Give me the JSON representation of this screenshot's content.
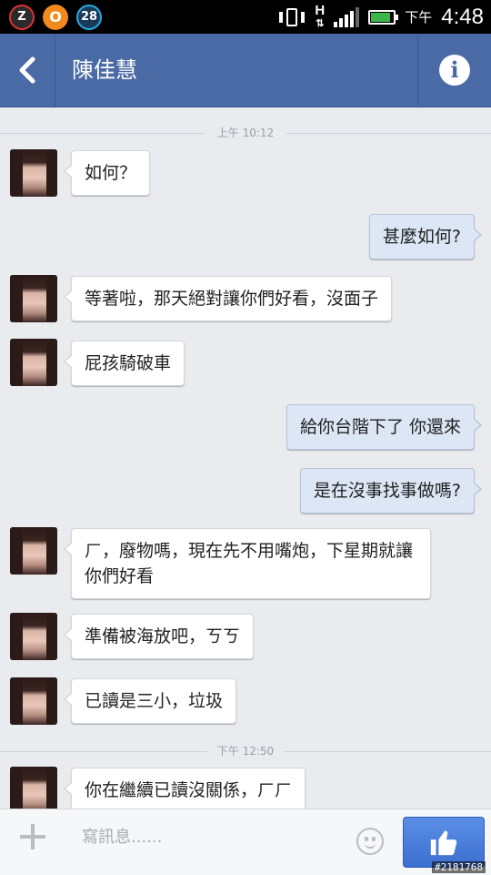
{
  "status_bar": {
    "badge_z": "Z",
    "badge_o": "O",
    "badge_28": "28",
    "network": "H",
    "ampm": "下午",
    "time": "4:48",
    "battery_level": 0.85
  },
  "header": {
    "contact_name": "陳佳慧",
    "back_icon": "chevron-left-icon",
    "info_icon": "info-icon",
    "info_symbol": "i"
  },
  "chat": {
    "timestamps": [
      "上午 10:12",
      "下午 12:50"
    ],
    "messages": [
      {
        "from": "them",
        "text": "如何？"
      },
      {
        "from": "me",
        "text": "甚麼如何?"
      },
      {
        "from": "them",
        "text": "等著啦，那天絕對讓你們好看，沒面子"
      },
      {
        "from": "them",
        "text": "屁孩騎破車"
      },
      {
        "from": "me",
        "text": "給你台階下了 你還來"
      },
      {
        "from": "me",
        "text": "是在沒事找事做嗎?"
      },
      {
        "from": "them",
        "text": "ㄏ，廢物嗎，現在先不用嘴炮，下星期就讓你們好看"
      },
      {
        "from": "them",
        "text": "準備被海放吧，ㄎㄎ"
      },
      {
        "from": "them",
        "text": "已讀是三小，垃圾"
      },
      {
        "from": "them",
        "text": "你在繼續已讀沒關係，ㄏㄏ"
      }
    ]
  },
  "composer": {
    "placeholder": "寫訊息......",
    "plus_icon": "plus-icon",
    "emoji_icon": "smiley-icon",
    "send_icon": "thumbs-up-icon"
  },
  "watermark": "#2181768",
  "colors": {
    "header": "#4a6aa5",
    "outgoing_bubble": "#dce6f5",
    "incoming_bubble": "#ffffff",
    "like_button": "#3d6fd0"
  }
}
